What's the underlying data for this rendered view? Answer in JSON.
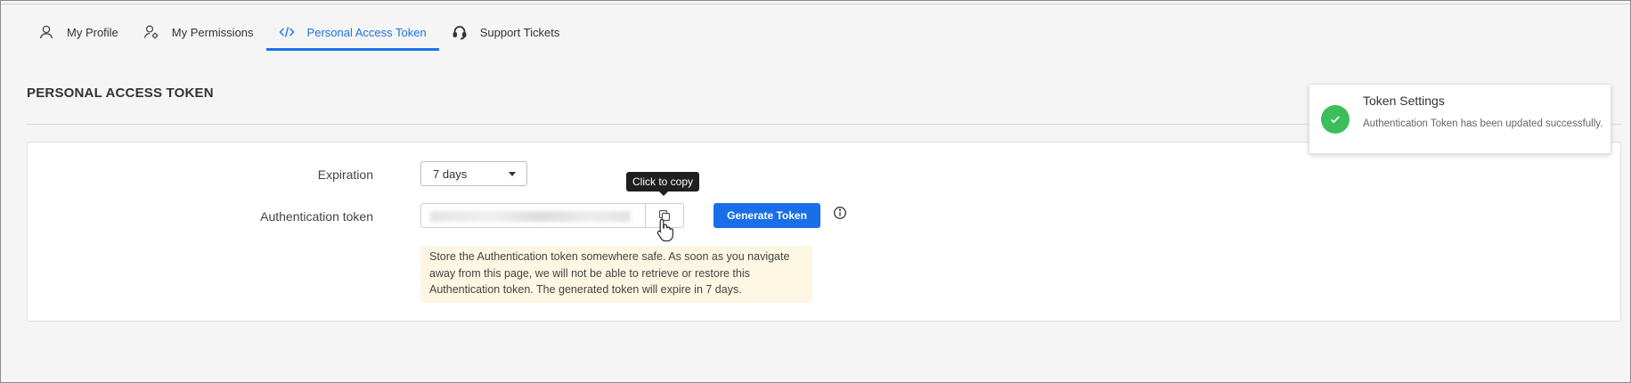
{
  "tabs": [
    {
      "label": "My Profile",
      "icon": "user-icon",
      "active": false
    },
    {
      "label": "My Permissions",
      "icon": "user-gear-icon",
      "active": false
    },
    {
      "label": "Personal Access Token",
      "icon": "code-icon",
      "active": true
    },
    {
      "label": "Support Tickets",
      "icon": "headset-icon",
      "active": false
    }
  ],
  "page": {
    "title": "PERSONAL ACCESS TOKEN"
  },
  "form": {
    "expiration_label": "Expiration",
    "expiration_value": "7 days",
    "auth_token_label": "Authentication token",
    "copy_tooltip": "Click to copy",
    "generate_label": "Generate Token",
    "notice": "Store the Authentication token somewhere safe. As soon as you navigate away from this page, we will not be able to retrieve or restore this Authentication token. The generated token will expire in 7 days."
  },
  "toast": {
    "title": "Token Settings",
    "message": "Authentication Token has been updated successfully."
  },
  "colors": {
    "accent": "#1a73e8",
    "success": "#3cbf5a",
    "notice_bg": "#fdf6e3"
  }
}
